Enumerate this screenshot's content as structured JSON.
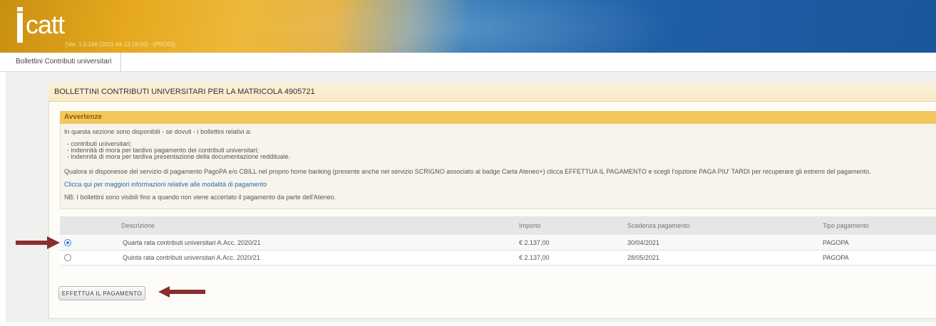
{
  "header": {
    "logo_text": "catt",
    "version": "[Ver. 1.0.166 (2021-04-13 18:56) - (PROD)]"
  },
  "tabs": [
    {
      "label": "Bollettini Contributi universitari"
    }
  ],
  "panel": {
    "title": "BOLLETTINI CONTRIBUTI UNIVERSITARI PER LA MATRICOLA 4905721"
  },
  "warning": {
    "heading": "Avvertenze",
    "intro": "In questa sezione sono disponibili - se dovuti - i bollettini relativi a:",
    "items": [
      "- contributi universitari;",
      "- indennità di mora per tardivo pagamento dei contributi universitari;",
      "- indennità di mora per tardiva presentazione della documentazione reddituale."
    ],
    "pagopa_note": "Qualora si disponesse del servizio di pagamento PagoPA e/o CBILL nel proprio home banking (presente anche nel servizio SCRIGNO associato al badge Carta Ateneo+) clicca EFFETTUA IL PAGAMENTO e scegli l'opzione PAGA PIU' TARDI per recuperare gli estremi del pagamento.",
    "link": "Clicca qui per maggiori informazioni relative alle modalità di pagamento",
    "nb": "NB: I bollettini sono visibili fino a quando non viene accertato il pagamento da parte dell'Ateneo."
  },
  "table": {
    "headers": [
      "Descrizione",
      "Importo",
      "Scadenza pagamento",
      "Tipo pagamento"
    ],
    "rows": [
      {
        "selected": true,
        "descrizione": "Quarta rata contributi universitari A.Acc. 2020/21",
        "importo": "€ 2.137,00",
        "scadenza": "30/04/2021",
        "tipo": "PAGOPA"
      },
      {
        "selected": false,
        "descrizione": "Quinta rata contributi universitari A.Acc. 2020/21",
        "importo": "€ 2.137,00",
        "scadenza": "28/05/2021",
        "tipo": "PAGOPA"
      }
    ]
  },
  "actions": {
    "pay_label": "EFFETTUA IL PAGAMENTO"
  },
  "colors": {
    "annotation_arrow": "#8b2e2e",
    "warning_header": "#f2c85a",
    "header_blue": "#1f5fa6",
    "header_gold": "#e6a91f"
  }
}
